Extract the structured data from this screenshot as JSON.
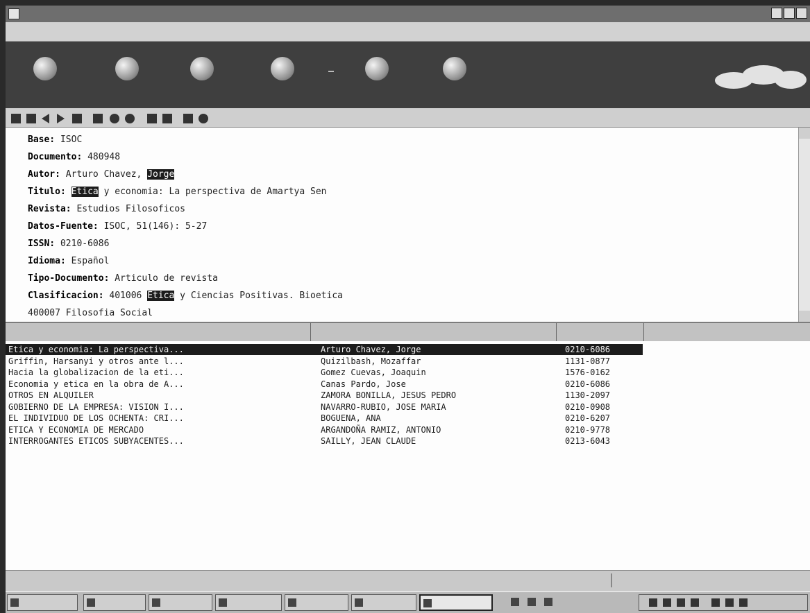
{
  "record": {
    "lines": [
      {
        "label": "Base:",
        "value": " ISOC"
      },
      {
        "label": "Documento:",
        "value": " 480948"
      },
      {
        "label": "Autor:",
        "value": " Arturo Chavez, ",
        "highlight": "Jorge",
        "after": ""
      },
      {
        "label": "Titulo:",
        "value": " ",
        "highlight": "Etica",
        "after": " y economia: La perspectiva de Amartya Sen"
      },
      {
        "label": "Revista:",
        "value": " Estudios Filosoficos"
      },
      {
        "label": "Datos-Fuente:",
        "value": " ISOC, 51(146): 5-27"
      },
      {
        "label": "ISSN:",
        "value": " 0210-6086"
      },
      {
        "label": "Idioma:",
        "value": " Español"
      },
      {
        "label": "Tipo-Documento:",
        "value": " Articulo de revista"
      },
      {
        "label": "Clasificacion:",
        "value": " 401006 ",
        "highlight": "Etica",
        "after": " y Ciencias Positivas. Bioetica"
      },
      {
        "label": "",
        "value": "400007 Filosofia Social"
      }
    ]
  },
  "results": {
    "rows": [
      {
        "title": "Etica y economia: La perspectiva...",
        "author": "Arturo Chavez, Jorge",
        "issn": "0210-6086",
        "selected": true
      },
      {
        "title": "Griffin, Harsanyi y otros ante l...",
        "author": "Quizilbash, Mozaffar",
        "issn": "1131-0877"
      },
      {
        "title": "Hacia la globalizacion de la eti...",
        "author": "Gomez Cuevas, Joaquin",
        "issn": "1576-0162"
      },
      {
        "title": "Economia y etica en la obra de A...",
        "author": "Canas Pardo, Jose",
        "issn": "0210-6086"
      },
      {
        "title": "OTROS EN ALQUILER",
        "author": "ZAMORA BONILLA, JESUS PEDRO",
        "issn": "1130-2097"
      },
      {
        "title": "GOBIERNO DE LA EMPRESA: VISION I...",
        "author": "NAVARRO-RUBIO, JOSE MARIA",
        "issn": "0210-0908"
      },
      {
        "title": "EL INDIVIDUO DE LOS OCHENTA: CRI...",
        "author": "BOGUENA, ANA",
        "issn": "0210-6207"
      },
      {
        "title": "ETICA Y ECONOMIA DE MERCADO",
        "author": "ARGANDOÑA RAMIZ, ANTONIO",
        "issn": "0210-9778"
      },
      {
        "title": "INTERROGANTES ETICOS SUBYACENTES...",
        "author": "SAILLY, JEAN CLAUDE",
        "issn": "0213-6043"
      }
    ]
  },
  "toolbar": {
    "buttons": [
      {
        "icon": "nueva-busqueda-icon"
      },
      {
        "icon": "ver-todos-icon"
      },
      {
        "icon": "imprimir-icon"
      },
      {
        "icon": "guardar-icon"
      },
      {
        "icon": "ayuda-icon"
      },
      {
        "icon": "salir-icon"
      }
    ]
  },
  "colors": {
    "selection": "#1c1c1c",
    "toolbar_band": "#3f3f3f",
    "record_bg": "#fdfdfd"
  }
}
